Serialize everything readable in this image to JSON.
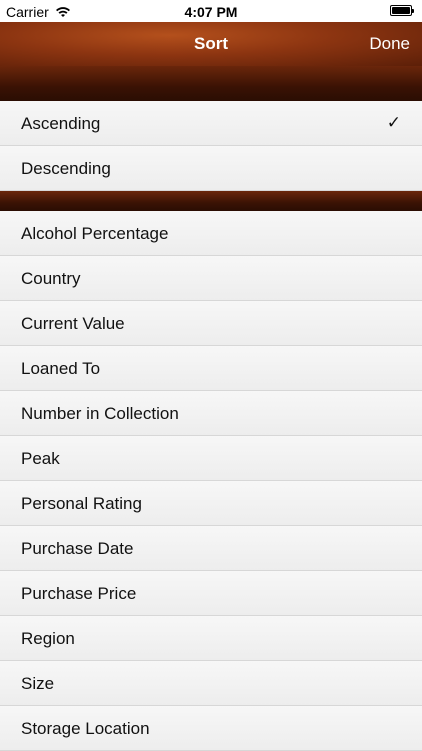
{
  "status": {
    "carrier": "Carrier",
    "time": "4:07 PM"
  },
  "nav": {
    "title": "Sort",
    "done": "Done"
  },
  "order_options": [
    {
      "label": "Ascending",
      "checked": true
    },
    {
      "label": "Descending",
      "checked": false
    }
  ],
  "check_mark": "✓",
  "sort_fields": [
    "Alcohol Percentage",
    "Country",
    "Current Value",
    "Loaned To",
    "Number in Collection",
    "Peak",
    "Personal Rating",
    "Purchase Date",
    "Purchase Price",
    "Region",
    "Size",
    "Storage Location"
  ]
}
